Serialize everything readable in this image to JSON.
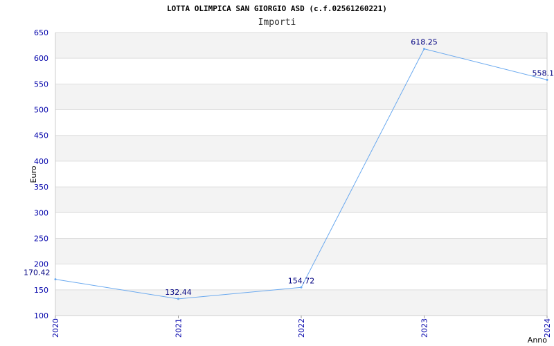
{
  "chart_data": {
    "type": "line",
    "title": "LOTTA OLIMPICA SAN GIORGIO ASD (c.f.02561260221)",
    "subtitle": "Importi",
    "xlabel": "Anno",
    "ylabel": "Euro",
    "categories": [
      "2020",
      "2021",
      "2022",
      "2023",
      "2024"
    ],
    "series": [
      {
        "values": [
          170.42,
          132.44,
          154.72,
          618.25,
          558.1
        ],
        "labels": [
          "170.42",
          "132.44",
          "154.72",
          "618.25",
          "558.1"
        ]
      }
    ],
    "ylim": [
      100,
      650
    ],
    "yticks": [
      100,
      150,
      200,
      250,
      300,
      350,
      400,
      450,
      500,
      550,
      600,
      650
    ],
    "grid": true,
    "colors": {
      "line": "#6aa9ef",
      "axis_text": "#0000aa",
      "label_text": "#000080",
      "band": "#f3f3f3",
      "grid": "#dddddd"
    }
  }
}
